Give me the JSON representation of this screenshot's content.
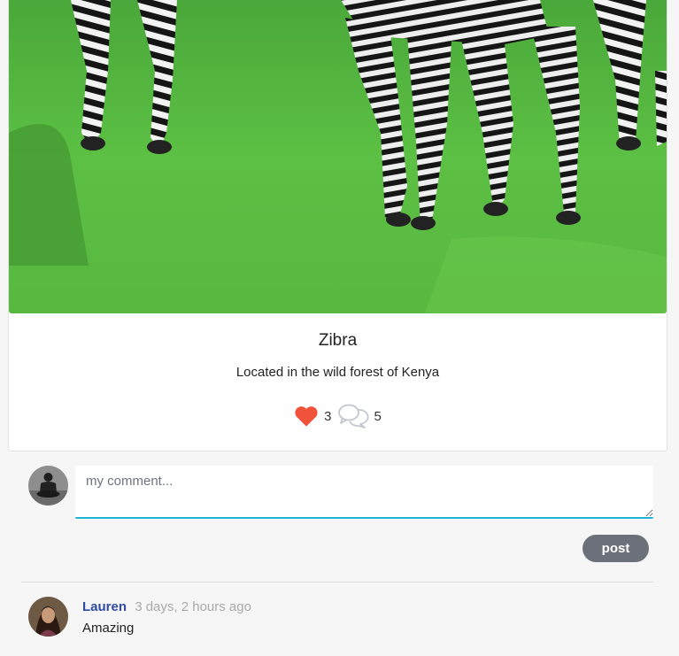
{
  "post": {
    "image_subject": "zebras grazing on grass",
    "title": "Zibra",
    "description": "Located in the wild forest of Kenya",
    "likes": "3",
    "comments_count": "5",
    "like_color": "#f0523a"
  },
  "comment_form": {
    "placeholder": "my comment...",
    "value": "",
    "post_label": "post"
  },
  "comments": [
    {
      "author": "Lauren",
      "time": "3 days, 2 hours ago",
      "text": "Amazing"
    }
  ],
  "colors": {
    "accent": "#1fb6d6",
    "author_link": "#2f4aa3",
    "button": "#6c707a"
  }
}
